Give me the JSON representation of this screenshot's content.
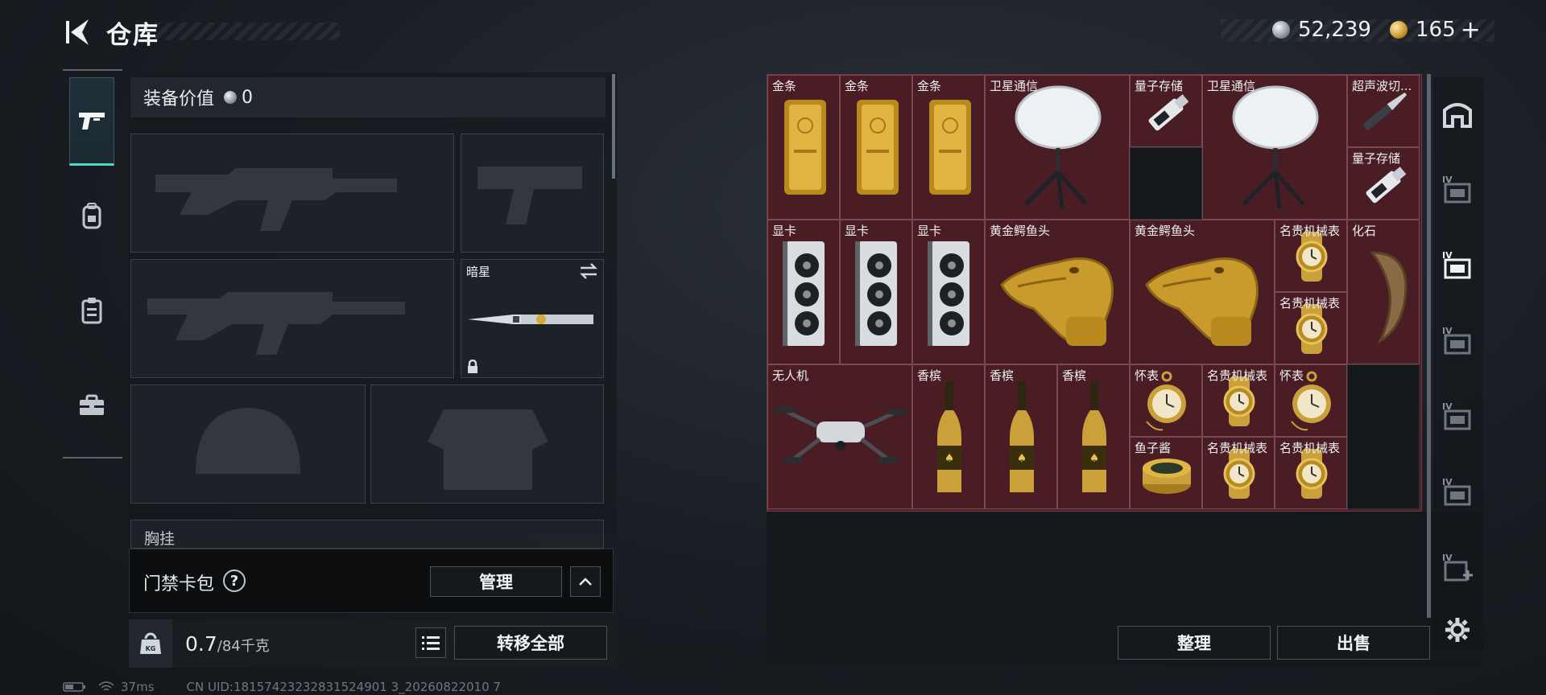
{
  "header": {
    "title": "仓库",
    "silver": "52,239",
    "gold": "165",
    "gold_plus": "+"
  },
  "leftnav": {
    "items": [
      "weapon-pistol-icon",
      "backpack-icon",
      "clipboard-icon",
      "toolbox-icon"
    ]
  },
  "equip": {
    "value_label": "装备价值",
    "value": "0",
    "melee_name": "暗星",
    "chest_label": "胸挂"
  },
  "card": {
    "label": "门禁卡包",
    "help": "?",
    "manage_label": "管理"
  },
  "weight": {
    "current": "0.7",
    "max": "/84千克",
    "kg_badge": "KG",
    "transfer_all": "转移全部"
  },
  "status": {
    "ping": "37ms",
    "uid": "CN UID:18157423232831524901 3_20260822010 7"
  },
  "storage": {
    "items": [
      {
        "name": "金条",
        "icon": "gold-bar"
      },
      {
        "name": "金条",
        "icon": "gold-bar"
      },
      {
        "name": "金条",
        "icon": "gold-bar"
      },
      {
        "name": "卫星通信",
        "icon": "satellite-dish"
      },
      {
        "name": "量子存储",
        "icon": "usb-drive"
      },
      {
        "name": "卫星通信",
        "icon": "satellite-dish"
      },
      {
        "name": "超声波切...",
        "icon": "scalpel"
      },
      {
        "name": "量子存储",
        "icon": "usb-drive"
      },
      {
        "name": "显卡",
        "icon": "gpu"
      },
      {
        "name": "显卡",
        "icon": "gpu"
      },
      {
        "name": "显卡",
        "icon": "gpu"
      },
      {
        "name": "黄金鳄鱼头",
        "icon": "gold-crocodile-head"
      },
      {
        "name": "黄金鳄鱼头",
        "icon": "gold-crocodile-head"
      },
      {
        "name": "名贵机械表",
        "icon": "watch"
      },
      {
        "name": "化石",
        "icon": "fossil-claw"
      },
      {
        "name": "名贵机械表",
        "icon": "watch"
      },
      {
        "name": "无人机",
        "icon": "drone"
      },
      {
        "name": "香槟",
        "icon": "champagne"
      },
      {
        "name": "香槟",
        "icon": "champagne"
      },
      {
        "name": "香槟",
        "icon": "champagne"
      },
      {
        "name": "怀表",
        "icon": "pocket-watch"
      },
      {
        "name": "名贵机械表",
        "icon": "watch"
      },
      {
        "name": "怀表",
        "icon": "pocket-watch"
      },
      {
        "name": "鱼子酱",
        "icon": "caviar-tin"
      },
      {
        "name": "名贵机械表",
        "icon": "watch"
      },
      {
        "name": "名贵机械表",
        "icon": "watch"
      }
    ],
    "sort_label": "整理",
    "sell_label": "出售"
  },
  "rtabs": [
    "home-icon",
    "container-IV",
    "container-IV-active",
    "container-IV",
    "container-IV",
    "container-IV",
    "container-IV-add",
    "gear-icon"
  ],
  "colors": {
    "accent": "#4fd7c5",
    "grid_bg": "#4a1d24",
    "grid_border": "#7a4a50"
  }
}
